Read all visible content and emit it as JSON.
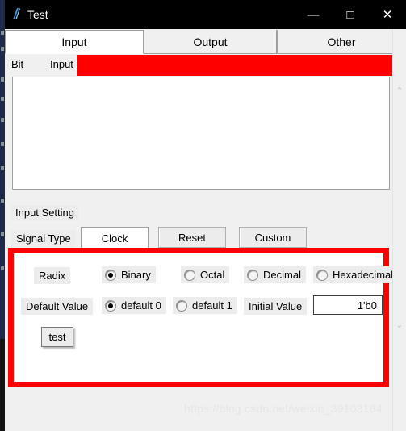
{
  "window": {
    "title": "Test",
    "icon": "feather-icon",
    "controls": {
      "minimize": "—",
      "maximize": "□",
      "close": "✕"
    }
  },
  "tabs": [
    {
      "label": "Input",
      "selected": true
    },
    {
      "label": "Output",
      "selected": false
    },
    {
      "label": "Other",
      "selected": false
    }
  ],
  "columns": {
    "bit": "Bit",
    "input": "Input"
  },
  "input_setting": {
    "title": "Input Setting",
    "signal_type_label": "Signal Type",
    "signal_types": [
      {
        "label": "Clock",
        "selected": true
      },
      {
        "label": "Reset",
        "selected": false
      },
      {
        "label": "Custom",
        "selected": false
      }
    ],
    "radix_label": "Radix",
    "radix_options": [
      {
        "label": "Binary",
        "checked": true
      },
      {
        "label": "Octal",
        "checked": false
      },
      {
        "label": "Decimal",
        "checked": false
      },
      {
        "label": "Hexadecimal",
        "checked": false
      }
    ],
    "default_value_label": "Default Value",
    "default_value_options": [
      {
        "label": "default 0",
        "checked": true
      },
      {
        "label": "default 1",
        "checked": false
      }
    ],
    "initial_value_label": "Initial Value",
    "initial_value": "1'b0",
    "initial_value_placeholder": "",
    "test_button": "test"
  },
  "scrollbar": {
    "up_arrow": "⌃",
    "down_arrow": "⌄"
  },
  "highlight_color": "#fe0000",
  "watermark": "https://blog.csdn.net/weixin_39103184"
}
